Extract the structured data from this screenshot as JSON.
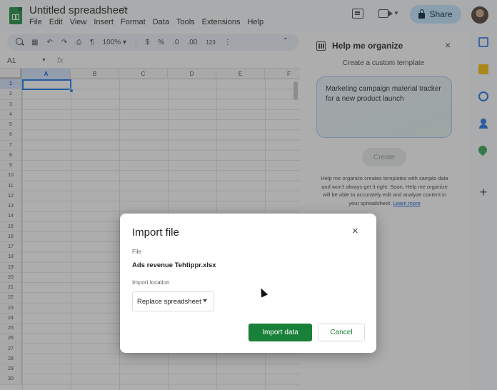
{
  "app": {
    "doc_title": "Untitled spreadsheet",
    "menu": [
      "File",
      "Edit",
      "View",
      "Insert",
      "Format",
      "Data",
      "Tools",
      "Extensions",
      "Help"
    ],
    "share_label": "Share"
  },
  "toolbar": {
    "zoom": "100%",
    "currency": "$",
    "percent": "%",
    "decrease_decimal": ".0",
    "increase_decimal": ".00",
    "number_format": "123"
  },
  "formula_bar": {
    "name_box": "A1",
    "fx": "fx"
  },
  "grid": {
    "columns": [
      "A",
      "B",
      "C",
      "D",
      "E",
      "F"
    ],
    "selected_column": "A",
    "rows": [
      "1",
      "2",
      "3",
      "4",
      "5",
      "6",
      "7",
      "8",
      "9",
      "10",
      "11",
      "12",
      "13",
      "14",
      "15",
      "16",
      "17",
      "18",
      "19",
      "20",
      "21",
      "22",
      "23",
      "24",
      "25",
      "26",
      "27",
      "28",
      "29",
      "30"
    ],
    "selected_row": "1"
  },
  "side_panel": {
    "title": "Help me organize",
    "subtitle": "Create a custom template",
    "prompt": "Marketing campaign material tracker for a new product launch",
    "create_label": "Create",
    "info": "Help me organize creates templates with sample data and won't always get it right. Soon, Help me organize will be able to accurately edit and analyze content in your spreadsheet.",
    "learn_more": "Learn more"
  },
  "dialog": {
    "title": "Import file",
    "file_label": "File",
    "file_name": "Ads revenue Tehtippr.xlsx",
    "location_label": "Import location",
    "location_value": "Replace spreadsheet",
    "import_label": "Import data",
    "cancel_label": "Cancel"
  },
  "icons": {
    "close": "×",
    "star": "☆",
    "add": "+"
  },
  "colors": {
    "accent": "#188038",
    "selection": "#1a73e8",
    "share_bg": "#c2e7ff"
  }
}
